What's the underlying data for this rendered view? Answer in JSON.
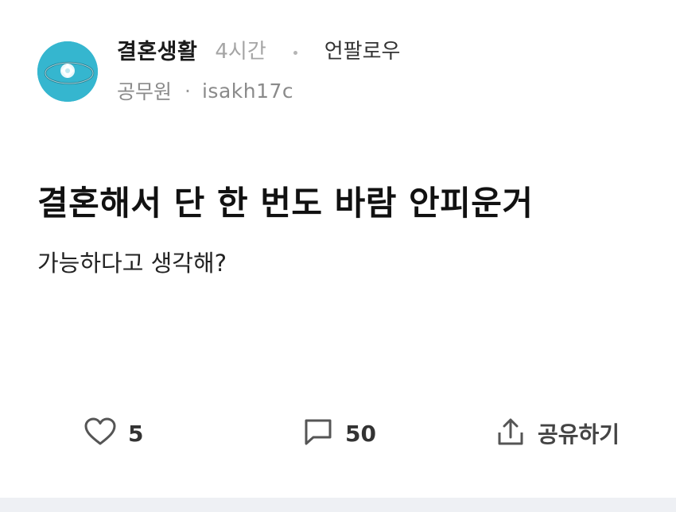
{
  "header": {
    "board_name": "결혼생활",
    "time_ago": "4시간",
    "unfollow_label": "언팔로우",
    "author_job": "공무원",
    "separator": "·",
    "username": "isakh17c",
    "avatar_icon": "ring-photo-avatar"
  },
  "post": {
    "title": "결혼해서 단 한 번도 바람 안피운거",
    "body": "가능하다고 생각해?"
  },
  "actions": {
    "like": {
      "icon": "heart-icon",
      "count": "5"
    },
    "comment": {
      "icon": "comment-icon",
      "count": "50"
    },
    "share": {
      "icon": "share-icon",
      "label": "공유하기"
    }
  },
  "colors": {
    "avatar_bg": "#35b6cf",
    "muted_text": "#8a8a8a",
    "bottom_bar": "#eef0f4"
  }
}
